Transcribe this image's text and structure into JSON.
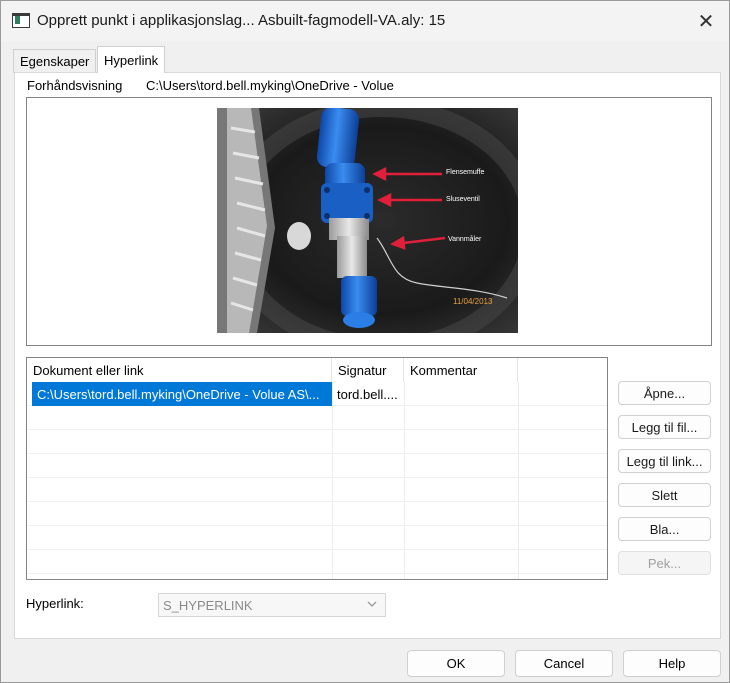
{
  "window": {
    "title": "Opprett punkt i applikasjonslag... Asbuilt-fagmodell-VA.aly: 15",
    "close_label": "✕"
  },
  "tabs": [
    {
      "label": "Egenskaper",
      "active": false
    },
    {
      "label": "Hyperlink",
      "active": true
    }
  ],
  "preview": {
    "label": "Forhåndsvisning",
    "path": "C:\\Users\\tord.bell.myking\\OneDrive - Volue",
    "image_annotations": [
      "Flensemuffe",
      "Sluseventil",
      "Vannmåler"
    ],
    "image_date": "11/04/2013"
  },
  "list": {
    "columns": [
      "Dokument eller link",
      "Signatur",
      "Kommentar"
    ],
    "rows": [
      {
        "document": "C:\\Users\\tord.bell.myking\\OneDrive - Volue AS\\...",
        "signature": "tord.bell....",
        "comment": "",
        "selected": true
      }
    ]
  },
  "side_buttons": {
    "open": "Åpne...",
    "add_file": "Legg til fil...",
    "add_link": "Legg til link...",
    "delete": "Slett",
    "browse": "Bla...",
    "point": "Pek..."
  },
  "hyperlink_field": {
    "label": "Hyperlink:",
    "value": "S_HYPERLINK"
  },
  "footer": {
    "ok": "OK",
    "cancel": "Cancel",
    "help": "Help"
  },
  "colors": {
    "selection": "#0078d7",
    "pipe_blue": "#1f6fd6",
    "annotation_red": "#e0203a"
  },
  "icons": {
    "app": "window-icon",
    "close": "close-icon",
    "dropdown": "chevron-down-icon"
  }
}
